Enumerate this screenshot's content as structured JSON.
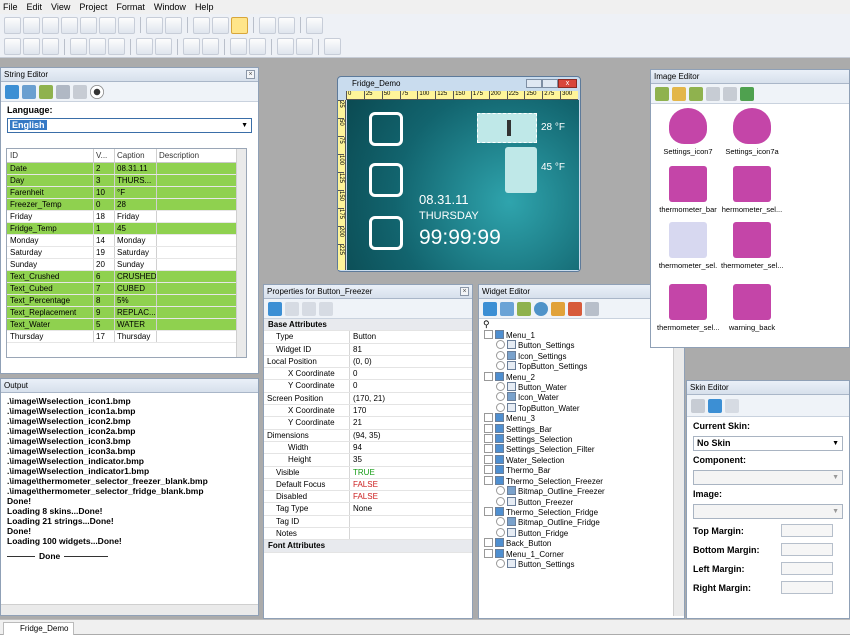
{
  "menu": [
    "File",
    "Edit",
    "View",
    "Project",
    "Format",
    "Window",
    "Help"
  ],
  "string_editor": {
    "title": "String Editor",
    "language_label": "Language:",
    "language": "English",
    "columns": [
      "ID",
      "V...",
      "Caption",
      "Description"
    ],
    "rows": [
      [
        "Date",
        "2",
        "08.31.11",
        ""
      ],
      [
        "Day",
        "3",
        "THURS...",
        ""
      ],
      [
        "Farenheit",
        "10",
        "°F",
        ""
      ],
      [
        "Freezer_Temp",
        "0",
        "28",
        ""
      ],
      [
        "Friday",
        "18",
        "Friday",
        ""
      ],
      [
        "Fridge_Temp",
        "1",
        "45",
        ""
      ],
      [
        "Monday",
        "14",
        "Monday",
        ""
      ],
      [
        "Saturday",
        "19",
        "Saturday",
        ""
      ],
      [
        "Sunday",
        "20",
        "Sunday",
        ""
      ],
      [
        "Text_Crushed",
        "6",
        "CRUSHED",
        ""
      ],
      [
        "Text_Cubed",
        "7",
        "CUBED",
        ""
      ],
      [
        "Text_Percentage",
        "8",
        "5%",
        ""
      ],
      [
        "Text_Replacement",
        "9",
        "REPLAC...",
        ""
      ],
      [
        "Text_Water",
        "5",
        "WATER",
        ""
      ],
      [
        "Thursday",
        "17",
        "Thursday",
        ""
      ]
    ],
    "green_rows": [
      0,
      1,
      2,
      3,
      5,
      9,
      10,
      11,
      12,
      13
    ]
  },
  "output": {
    "title": "Output",
    "lines": [
      ".\\image\\Wselection_icon1.bmp",
      ".\\image\\Wselection_icon1a.bmp",
      ".\\image\\Wselection_icon2.bmp",
      ".\\image\\Wselection_icon2a.bmp",
      ".\\image\\Wselection_icon3.bmp",
      ".\\image\\Wselection_icon3a.bmp",
      ".\\image\\Wselection_indicator.bmp",
      ".\\image\\Wselection_indicator1.bmp",
      ".\\image\\thermometer_selector_freezer_blank.bmp",
      ".\\image\\thermometer_selector_fridge_blank.bmp",
      "Done!",
      "Loading 8 skins...Done!",
      "Loading 21 strings...Done!",
      "Done!",
      "Loading 100 widgets...Done!"
    ],
    "done_label": "Done"
  },
  "fridge": {
    "title": "Fridge_Demo",
    "ruler": [
      "0",
      "25",
      "50",
      "75",
      "100",
      "125",
      "150",
      "175",
      "200",
      "225",
      "250",
      "275",
      "300"
    ],
    "vruler": [
      "25",
      "50",
      "75",
      "100",
      "125",
      "150",
      "175",
      "200",
      "225"
    ],
    "freezer_temp": "28 °F",
    "fridge_temp": "45 °F",
    "date": "08.31.11",
    "day": "THURSDAY",
    "time": "99:99:99"
  },
  "properties": {
    "title": "Properties for Button_Freezer",
    "section": "Base Attributes",
    "rows": [
      [
        "Type",
        "Button",
        "",
        0
      ],
      [
        "Widget ID",
        "81",
        "",
        0
      ],
      [
        "Local Position",
        "(0, 0)",
        "",
        2
      ],
      [
        "X Coordinate",
        "0",
        "",
        1
      ],
      [
        "Y Coordinate",
        "0",
        "",
        1
      ],
      [
        "Screen Position",
        "(170, 21)",
        "",
        2
      ],
      [
        "X Coordinate",
        "170",
        "",
        1
      ],
      [
        "Y Coordinate",
        "21",
        "",
        1
      ],
      [
        "Dimensions",
        "(94, 35)",
        "",
        2
      ],
      [
        "Width",
        "94",
        "",
        1
      ],
      [
        "Height",
        "35",
        "",
        1
      ],
      [
        "Visible",
        "TRUE",
        "green",
        0
      ],
      [
        "Default Focus",
        "FALSE",
        "red",
        0
      ],
      [
        "Disabled",
        "FALSE",
        "red",
        0
      ],
      [
        "Tag Type",
        "None",
        "",
        0
      ],
      [
        "Tag ID",
        "",
        "",
        0
      ],
      [
        "Notes",
        "",
        "",
        0
      ]
    ],
    "font_section": "Font Attributes"
  },
  "widget_editor": {
    "title": "Widget Editor",
    "tree": [
      [
        "Menu_1",
        0,
        "menu"
      ],
      [
        "Button_Settings",
        1,
        "btn"
      ],
      [
        "Icon_Settings",
        1,
        "icon"
      ],
      [
        "TopButton_Settings",
        1,
        "btn"
      ],
      [
        "Menu_2",
        0,
        "menu"
      ],
      [
        "Button_Water",
        1,
        "btn"
      ],
      [
        "Icon_Water",
        1,
        "icon"
      ],
      [
        "TopButton_Water",
        1,
        "btn"
      ],
      [
        "Menu_3",
        0,
        "menu"
      ],
      [
        "Settings_Bar",
        0,
        "menu"
      ],
      [
        "Settings_Selection",
        0,
        "menu"
      ],
      [
        "Settings_Selection_Filter",
        0,
        "menu"
      ],
      [
        "Water_Selection",
        0,
        "menu"
      ],
      [
        "Thermo_Bar",
        0,
        "menu"
      ],
      [
        "Thermo_Selection_Freezer",
        0,
        "menu"
      ],
      [
        "Bitmap_Outline_Freezer",
        1,
        "icon"
      ],
      [
        "Button_Freezer",
        1,
        "btn"
      ],
      [
        "Thermo_Selection_Fridge",
        0,
        "menu"
      ],
      [
        "Bitmap_Outline_Fridge",
        1,
        "icon"
      ],
      [
        "Button_Fridge",
        1,
        "btn"
      ],
      [
        "Back_Button",
        0,
        "menu"
      ],
      [
        "Menu_1_Corner",
        0,
        "menu"
      ],
      [
        "Button_Settings",
        1,
        "btn"
      ]
    ]
  },
  "image_editor": {
    "title": "Image Editor",
    "items": [
      "Settings_icon7",
      "Settings_icon7a",
      "thermometer_bar",
      "hermometer_sel...",
      "thermometer_sel.",
      "thermometer_sel...",
      "thermometer_sel...",
      "warning_back"
    ]
  },
  "skin_editor": {
    "title": "Skin Editor",
    "current_skin_label": "Current Skin:",
    "current_skin": "No Skin",
    "component_label": "Component:",
    "image_label": "Image:",
    "margins": [
      "Top Margin:",
      "Bottom Margin:",
      "Left Margin:",
      "Right Margin:"
    ]
  },
  "taskbar": {
    "item": "Fridge_Demo"
  },
  "colors": {
    "green_row": "#8fd14f",
    "teal": "#15757f",
    "accent": "#c8eaea",
    "pink": "#c445a8"
  }
}
